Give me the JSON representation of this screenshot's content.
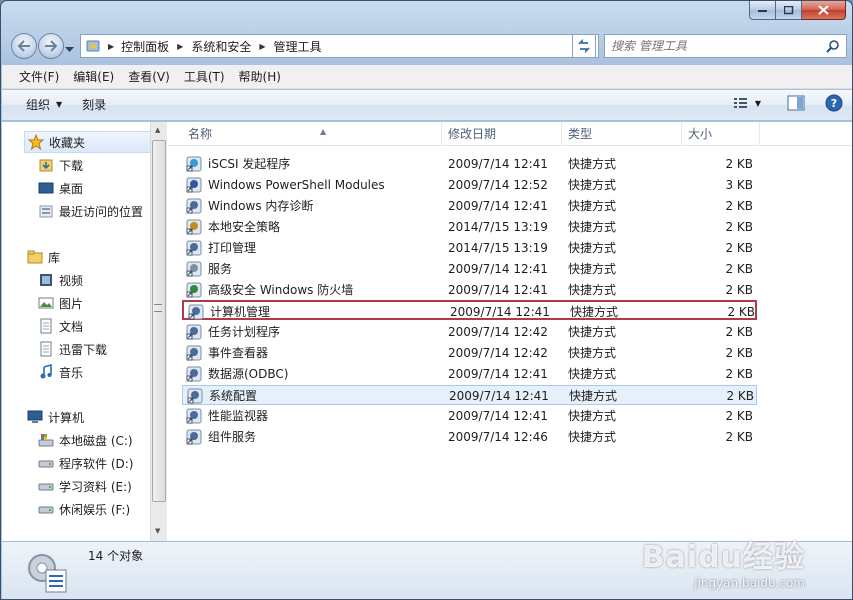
{
  "address": {
    "crumbs": [
      "控制面板",
      "系统和安全",
      "管理工具"
    ]
  },
  "search": {
    "placeholder": "搜索 管理工具"
  },
  "menu": [
    "文件(F)",
    "编辑(E)",
    "查看(V)",
    "工具(T)",
    "帮助(H)"
  ],
  "toolbar": {
    "organize": "组织",
    "burn": "刻录"
  },
  "sidebar": {
    "favorites": {
      "title": "收藏夹",
      "items": [
        "下载",
        "桌面",
        "最近访问的位置"
      ]
    },
    "libraries": {
      "title": "库",
      "items": [
        "视频",
        "图片",
        "文档",
        "迅雷下载",
        "音乐"
      ]
    },
    "computer": {
      "title": "计算机",
      "items": [
        "本地磁盘 (C:)",
        "程序软件 (D:)",
        "学习资料 (E:)",
        "休闲娱乐 (F:)"
      ]
    }
  },
  "columns": {
    "name": "名称",
    "date": "修改日期",
    "type": "类型",
    "size": "大小"
  },
  "files": [
    {
      "name": "iSCSI 发起程序",
      "date": "2009/7/14 12:41",
      "type": "快捷方式",
      "size": "2 KB"
    },
    {
      "name": "Windows PowerShell Modules",
      "date": "2009/7/14 12:52",
      "type": "快捷方式",
      "size": "3 KB"
    },
    {
      "name": "Windows 内存诊断",
      "date": "2009/7/14 12:41",
      "type": "快捷方式",
      "size": "2 KB"
    },
    {
      "name": "本地安全策略",
      "date": "2014/7/15 13:19",
      "type": "快捷方式",
      "size": "2 KB"
    },
    {
      "name": "打印管理",
      "date": "2014/7/15 13:19",
      "type": "快捷方式",
      "size": "2 KB"
    },
    {
      "name": "服务",
      "date": "2009/7/14 12:41",
      "type": "快捷方式",
      "size": "2 KB"
    },
    {
      "name": "高级安全 Windows 防火墙",
      "date": "2009/7/14 12:41",
      "type": "快捷方式",
      "size": "2 KB"
    },
    {
      "name": "计算机管理",
      "date": "2009/7/14 12:41",
      "type": "快捷方式",
      "size": "2 KB"
    },
    {
      "name": "任务计划程序",
      "date": "2009/7/14 12:42",
      "type": "快捷方式",
      "size": "2 KB"
    },
    {
      "name": "事件查看器",
      "date": "2009/7/14 12:42",
      "type": "快捷方式",
      "size": "2 KB"
    },
    {
      "name": "数据源(ODBC)",
      "date": "2009/7/14 12:41",
      "type": "快捷方式",
      "size": "2 KB"
    },
    {
      "name": "系统配置",
      "date": "2009/7/14 12:41",
      "type": "快捷方式",
      "size": "2 KB"
    },
    {
      "name": "性能监视器",
      "date": "2009/7/14 12:41",
      "type": "快捷方式",
      "size": "2 KB"
    },
    {
      "name": "组件服务",
      "date": "2009/7/14 12:46",
      "type": "快捷方式",
      "size": "2 KB"
    }
  ],
  "status": {
    "count": "14 个对象"
  },
  "watermark": {
    "logo": "Baidu经验",
    "url": "jingyan.baidu.com"
  },
  "colors": {
    "highlight_border": "#b23a48",
    "selection": "#e6f0fb",
    "accent": "#3a6ea5"
  }
}
